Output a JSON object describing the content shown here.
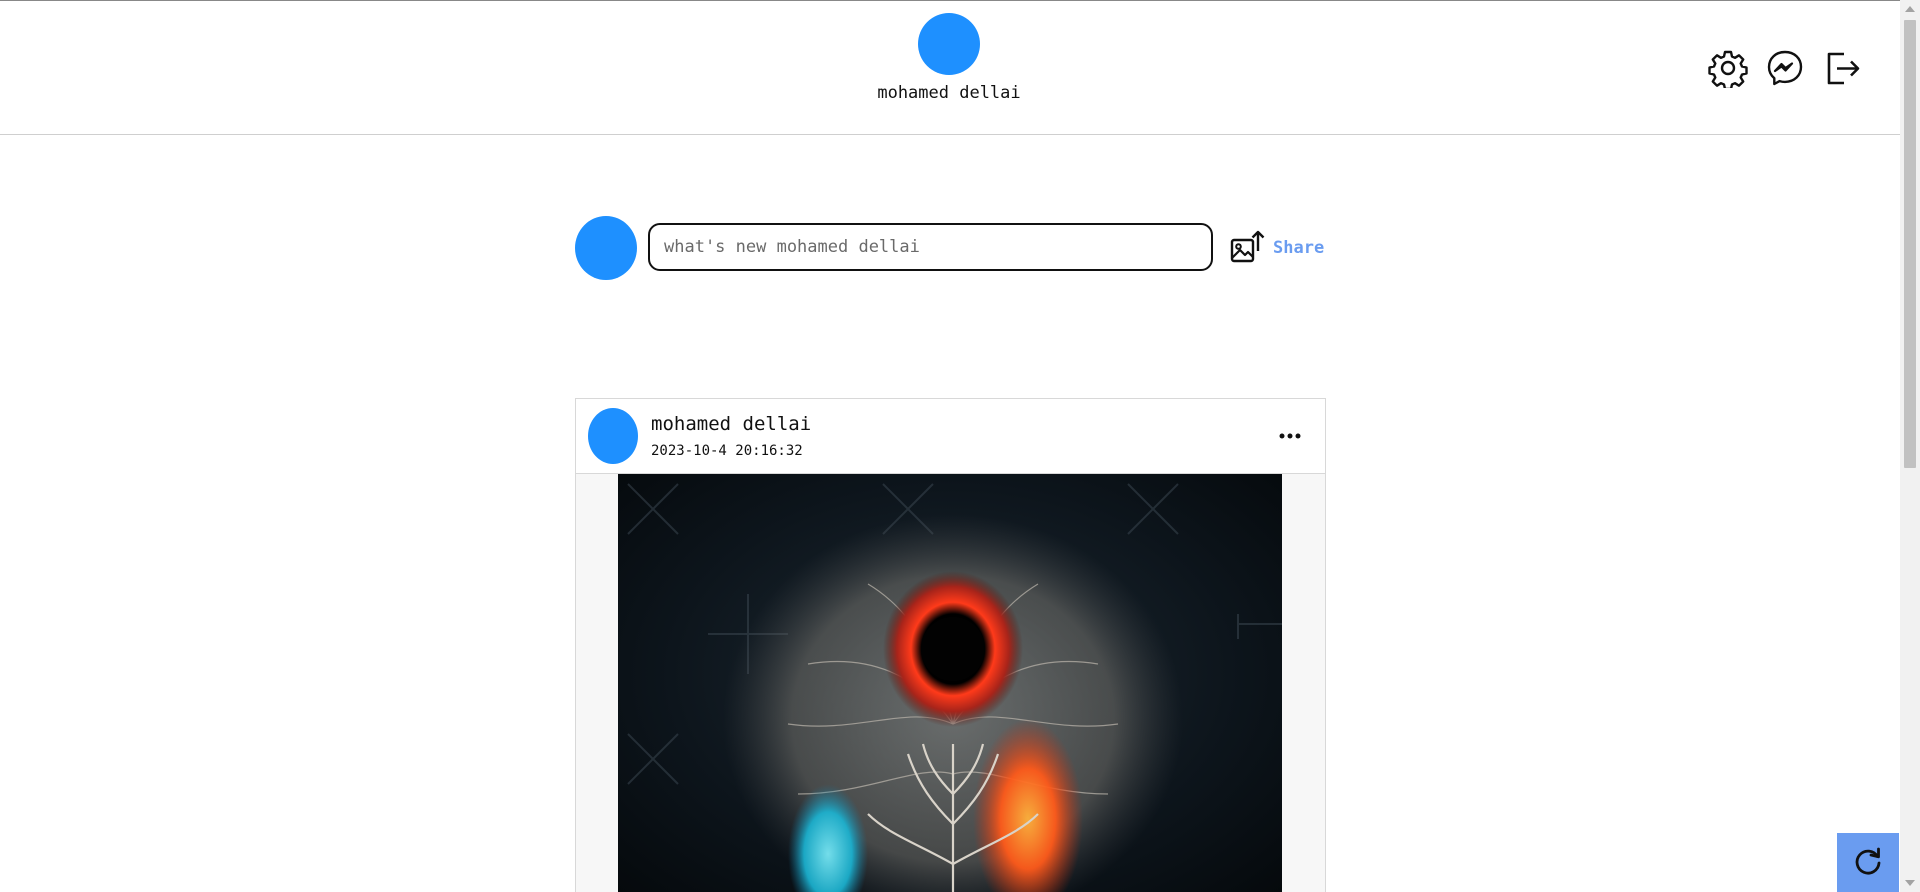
{
  "header": {
    "user_name": "mohamed dellai",
    "icons": [
      "gear-icon",
      "messenger-icon",
      "logout-icon"
    ]
  },
  "composer": {
    "placeholder": "what's new mohamed dellai",
    "value": "",
    "upload_icon": "image-upload-icon",
    "share_label": "Share"
  },
  "post": {
    "author": "mohamed dellai",
    "date": "2023-10-4 20:16:32",
    "menu_icon": "more-horizontal-icon"
  },
  "refresh_icon": "refresh-icon",
  "colors": {
    "avatar": "#1e90ff",
    "share_text": "#6a9cf0",
    "refresh_button": "#6a9cf0"
  }
}
